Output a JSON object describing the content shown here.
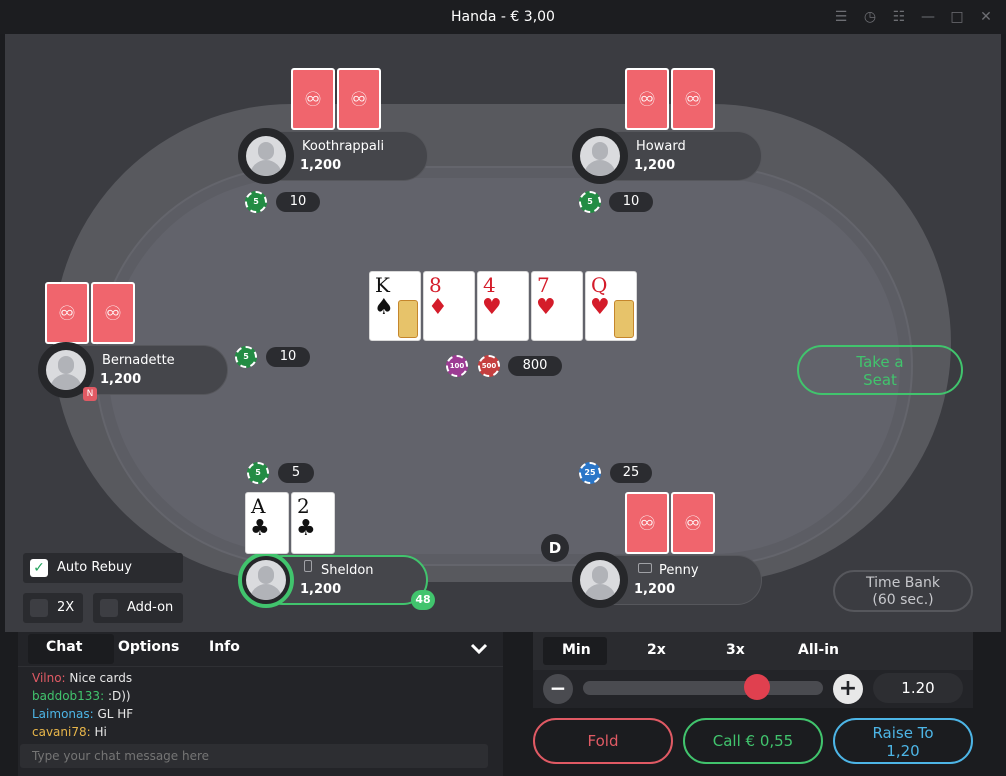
{
  "window": {
    "title": "Handa - € 3,00"
  },
  "window_controls": [
    {
      "name": "lobby-icon",
      "glyph": "☰"
    },
    {
      "name": "history-icon",
      "glyph": "◷"
    },
    {
      "name": "tables-icon",
      "glyph": "☷"
    },
    {
      "name": "minimize-icon",
      "glyph": "—"
    },
    {
      "name": "maximize-icon",
      "glyph": "□"
    },
    {
      "name": "close-icon",
      "glyph": "✕"
    }
  ],
  "players": {
    "koothrappali": {
      "name": "Koothrappali",
      "stack": "1,200",
      "bet": "10",
      "chip": "5"
    },
    "howard": {
      "name": "Howard",
      "stack": "1,200",
      "bet": "10",
      "chip": "5"
    },
    "bernadette": {
      "name": "Bernadette",
      "stack": "1,200",
      "bet": "10",
      "chip": "5",
      "badge": "N"
    },
    "sheldon": {
      "name": "Sheldon",
      "stack": "1,200",
      "bet": "5",
      "chip": "5",
      "timer": "48"
    },
    "penny": {
      "name": "Penny",
      "stack": "1,200",
      "bet": "25",
      "chip": "25"
    }
  },
  "hero_cards": [
    {
      "rank": "A",
      "suit": "♣",
      "color": "black"
    },
    {
      "rank": "2",
      "suit": "♣",
      "color": "black"
    }
  ],
  "board": [
    {
      "rank": "K",
      "suit": "♠",
      "color": "black",
      "face": true
    },
    {
      "rank": "8",
      "suit": "♦",
      "color": "red",
      "face": false
    },
    {
      "rank": "4",
      "suit": "♥",
      "color": "red",
      "face": false
    },
    {
      "rank": "7",
      "suit": "♥",
      "color": "red",
      "face": false
    },
    {
      "rank": "Q",
      "suit": "♥",
      "color": "red",
      "face": true
    }
  ],
  "card_back_logo": "♾",
  "pot": {
    "amount": "800",
    "chips": [
      "100",
      "500"
    ]
  },
  "dealer_button": "D",
  "take_seat": {
    "line1": "Take a",
    "line2": "Seat"
  },
  "time_bank": {
    "line1": "Time Bank",
    "line2": "(60 sec.)"
  },
  "options_left": {
    "auto_rebuy": {
      "label": "Auto Rebuy",
      "checked": true
    },
    "two_x": {
      "label": "2X",
      "checked": false
    },
    "add_on": {
      "label": "Add-on",
      "checked": false
    }
  },
  "chat_panel": {
    "tabs": [
      "Chat",
      "Options",
      "Info"
    ],
    "collapse_glyph": "✔",
    "messages": [
      {
        "user": "Vilno:",
        "text": " Nice cards",
        "color": "#e05a64"
      },
      {
        "user": "baddob133:",
        "text": " :D))",
        "color": "#41c46d"
      },
      {
        "user": "Laimonas:",
        "text": " GL HF",
        "color": "#4db5e6"
      },
      {
        "user": "cavani78:",
        "text": " Hi",
        "color": "#e8b64a"
      }
    ],
    "input_placeholder": "Type your chat message here"
  },
  "bet_panel": {
    "presets": [
      "Min",
      "2x",
      "3x",
      "All-in"
    ],
    "minus": "−",
    "plus": "+",
    "amount": "1.20",
    "slider_fraction": 0.75
  },
  "actions": {
    "fold": "Fold",
    "call": "Call € 0,55",
    "raise_line1": "Raise To",
    "raise_line2": "1,20"
  },
  "colors": {
    "fold": "#e05a64",
    "call": "#41c46d",
    "raise": "#4db5e6",
    "slider_thumb": "#e0404f",
    "accent_green": "#41c46d"
  }
}
